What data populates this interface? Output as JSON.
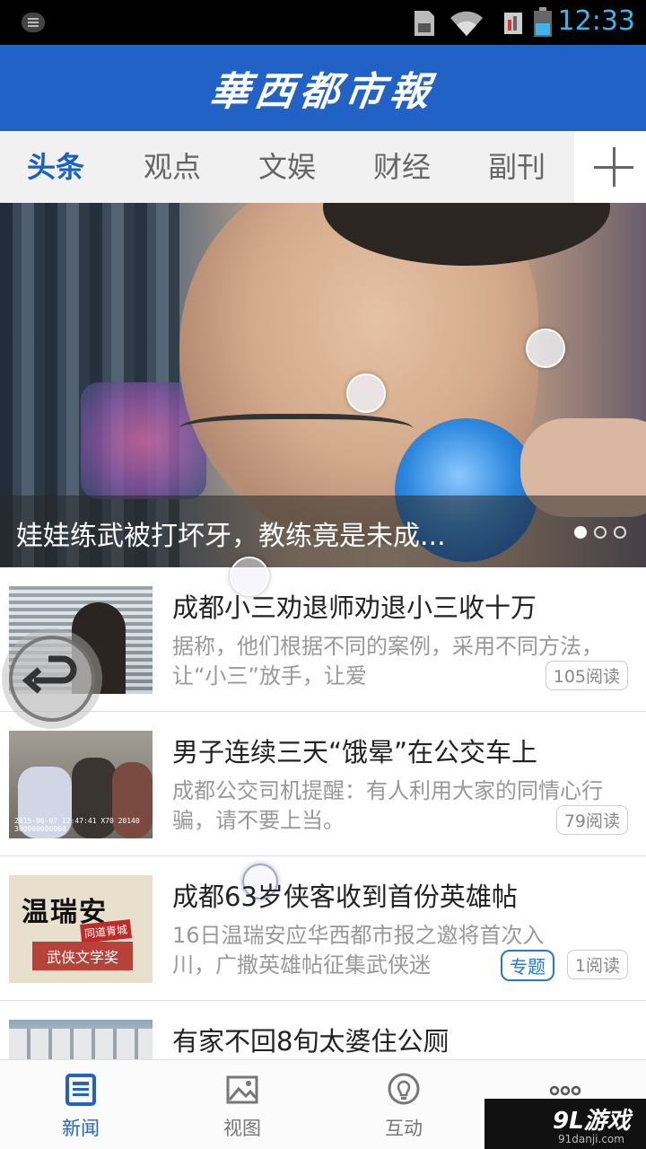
{
  "status_bar": {
    "time": "12:33"
  },
  "header": {
    "logo_text": "華西都市報"
  },
  "tabs": [
    {
      "label": "头条",
      "active": true
    },
    {
      "label": "观点",
      "active": false
    },
    {
      "label": "文娱",
      "active": false
    },
    {
      "label": "财经",
      "active": false
    },
    {
      "label": "副刊",
      "active": false
    }
  ],
  "hero": {
    "caption": "娃娃练武被打坏牙，教练竟是未成...",
    "slide_count": 3,
    "active_slide": 1
  },
  "news": [
    {
      "title": "成都小三劝退师劝退小三收十万",
      "summary": "据称，他们根据不同的案例，采用不同方法，让“小三”放手，让爱",
      "reads": "105阅读"
    },
    {
      "title": "男子连续三天“饿晕”在公交车上",
      "summary": "成都公交司机提醒：有人利用大家的同情心行骗，请不要上当。",
      "reads": "79阅读",
      "thumb_timestamp": "2015-06-07 12:47:41 X70 20140 300000000000"
    },
    {
      "title": "成都63岁侠客收到首份英雄帖",
      "summary": "16日温瑞安应华西都市报之邀将首次入川，广撒英雄帖征集武侠迷",
      "reads": "1阅读",
      "topic": "专题",
      "thumb_text": {
        "name": "温瑞安",
        "seal": "同道青城",
        "award": "武侠文学奖"
      }
    },
    {
      "title": "有家不回8旬太婆住公厕"
    }
  ],
  "bottom_nav": [
    {
      "label": "新闻",
      "icon": "newspaper-icon",
      "active": true
    },
    {
      "label": "视图",
      "icon": "image-icon",
      "active": false
    },
    {
      "label": "互动",
      "icon": "lightbulb-icon",
      "active": false
    },
    {
      "label": "",
      "icon": "more-dots-icon",
      "active": false
    }
  ],
  "watermark": {
    "main": "9L游戏",
    "sub": "91danji.com"
  },
  "colors": {
    "brand_blue": "#2262c6",
    "status_clock": "#3fb4e8",
    "topic_blue": "#2a77cc"
  }
}
